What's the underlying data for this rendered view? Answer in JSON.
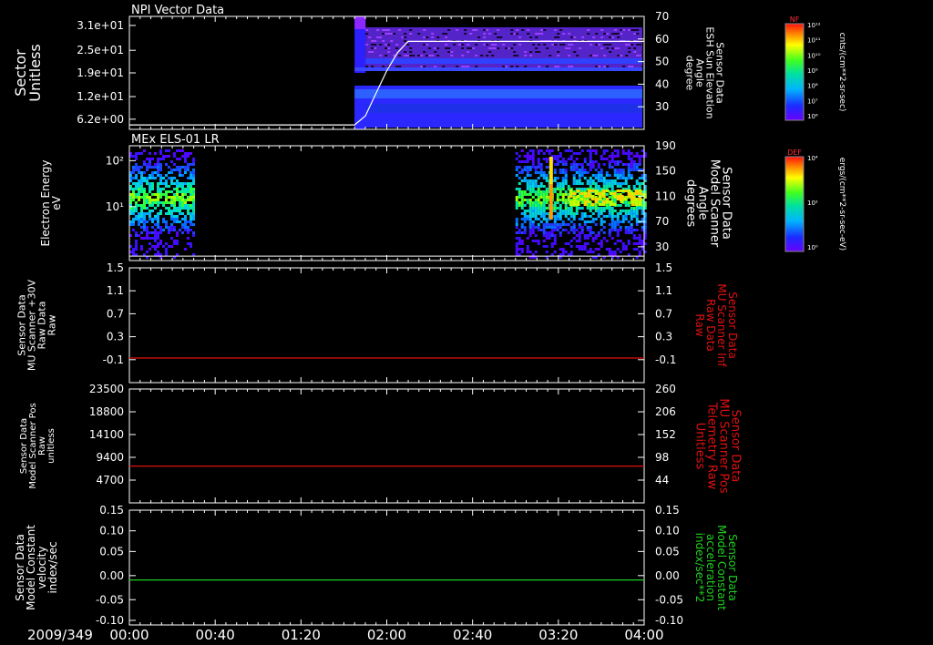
{
  "date_label": "2009/349",
  "time_ticks": [
    "00:00",
    "00:40",
    "01:20",
    "02:00",
    "02:40",
    "03:20",
    "04:00"
  ],
  "colors": {
    "bg": "#000000",
    "fg": "#ffffff",
    "red_trace": "#e01010",
    "green_trace": "#20d020",
    "white_trace": "#ffffff"
  },
  "panels": [
    {
      "id": "npi",
      "title": "NPI Vector Data",
      "left_label": [
        "Sector",
        "Unitless"
      ],
      "left_ticks": [
        "3.1e+01",
        "2.5e+01",
        "1.9e+01",
        "1.2e+01",
        "6.2e+00"
      ],
      "right_label": [
        "Sensor Data",
        "ESH Sun Elevation",
        "Angle",
        "degree"
      ],
      "right_label_color": "white",
      "right_ticks": [
        "70",
        "60",
        "50",
        "40",
        "30"
      ],
      "colorbar": {
        "name": "NF",
        "unit": "cnts/(cm**2-sr-sec)",
        "ticks": [
          "10¹²",
          "10¹¹",
          "10¹⁰",
          "10⁹",
          "10⁸",
          "10⁷",
          "10⁶"
        ]
      }
    },
    {
      "id": "els",
      "title": "MEx ELS-01 LR",
      "left_label": [
        "Electron Energy",
        "eV"
      ],
      "left_ticks": [
        "10²",
        "10¹"
      ],
      "right_label": [
        "Sensor Data",
        "Model Scanner",
        "Angle",
        "degrees"
      ],
      "right_label_color": "white",
      "right_ticks": [
        "190",
        "150",
        "110",
        "70",
        "30"
      ],
      "colorbar": {
        "name": "DEF",
        "unit": "ergs/(cm**2-sr-sec-eV)",
        "ticks": [
          "10⁴",
          "10²",
          "10⁰"
        ]
      }
    },
    {
      "id": "mu30",
      "title": "",
      "left_label": [
        "Sensor Data",
        "MU Scanner +30V",
        "Raw Data",
        "Raw"
      ],
      "left_ticks": [
        "1.5",
        "1.1",
        "0.7",
        "0.3",
        "-0.1"
      ],
      "right_label": [
        "Sensor Data",
        "MU Scanner Inf",
        "Raw Data",
        "Raw"
      ],
      "right_label_color": "red",
      "right_ticks": [
        "1.5",
        "1.1",
        "0.7",
        "0.3",
        "-0.1"
      ]
    },
    {
      "id": "mupos",
      "title": "",
      "left_label": [
        "Sensor Data",
        "Model Scanner Pos",
        "Raw",
        "unitless"
      ],
      "left_ticks": [
        "23500",
        "18800",
        "14100",
        "9400",
        "4700"
      ],
      "right_label": [
        "Sensor Data",
        "MU Scanner Pos",
        "Telemetry Raw",
        "Unitless"
      ],
      "right_label_color": "red",
      "right_ticks": [
        "260",
        "206",
        "152",
        "98",
        "44"
      ]
    },
    {
      "id": "const",
      "title": "",
      "left_label": [
        "Sensor Data",
        "Model Constant",
        "velocity",
        "index/sec"
      ],
      "left_ticks": [
        "0.15",
        "0.10",
        "0.05",
        "0.00",
        "-0.05",
        "-0.10"
      ],
      "right_label": [
        "Sensor Data",
        "Model Constant",
        "acceleration",
        "index/sec**2"
      ],
      "right_label_color": "green",
      "right_ticks": [
        "0.15",
        "0.10",
        "0.05",
        "0.00",
        "-0.05",
        "-0.10"
      ]
    }
  ],
  "chart_data": [
    {
      "type": "heatmap",
      "title": "NPI Vector Data",
      "x_unit": "time",
      "xlim": [
        "00:00",
        "04:00"
      ],
      "ylabel": "Sector Unitless",
      "ylim": [
        0,
        31
      ],
      "data_start": "01:45",
      "overlay_series": {
        "label": "Sensor Data ESH Sun Elevation Angle degree",
        "axis_range": [
          20,
          70
        ],
        "x": [
          "00:00",
          "01:45",
          "01:50",
          "01:55",
          "02:00",
          "02:05",
          "02:10",
          "04:00"
        ],
        "y": [
          26,
          26,
          30,
          40,
          50,
          58,
          63,
          63
        ]
      }
    },
    {
      "type": "heatmap",
      "title": "MEx ELS-01 LR",
      "ylabel": "Electron Energy eV",
      "ylim": [
        1,
        200
      ],
      "log_y": true,
      "data_intervals": [
        [
          "00:00",
          "00:30"
        ],
        [
          "03:00",
          "04:00"
        ]
      ],
      "overlay_series": {
        "label": "Sensor Data Model Scanner Angle degrees",
        "axis_range": [
          10,
          190
        ],
        "x": [
          "00:00",
          "04:00"
        ],
        "y": [
          17,
          17
        ]
      }
    },
    {
      "type": "line",
      "series": [
        {
          "name": "Sensor Data MU Scanner Inf Raw Data Raw",
          "x": [
            "00:00",
            "04:00"
          ],
          "y": [
            0.0,
            0.0
          ]
        }
      ],
      "ylabel": "Sensor Data MU Scanner +30V Raw Data Raw",
      "ylim": [
        -0.3,
        1.5
      ]
    },
    {
      "type": "line",
      "series": [
        {
          "name": "Sensor Data MU Scanner Pos Telemetry Raw Unitless",
          "x": [
            "00:00",
            "04:00"
          ],
          "y": [
            86,
            86
          ]
        }
      ],
      "ylabel": "Sensor Data Model Scanner Pos Raw unitless",
      "ylim": [
        0,
        23500
      ],
      "right_ylim": [
        0,
        260
      ]
    },
    {
      "type": "line",
      "series": [
        {
          "name": "Sensor Data Model Constant acceleration index/sec**2",
          "x": [
            "00:00",
            "04:00"
          ],
          "y": [
            0.0,
            0.0
          ]
        }
      ],
      "ylabel": "Sensor Data Model Constant velocity index/sec",
      "ylim": [
        -0.1,
        0.15
      ]
    }
  ]
}
